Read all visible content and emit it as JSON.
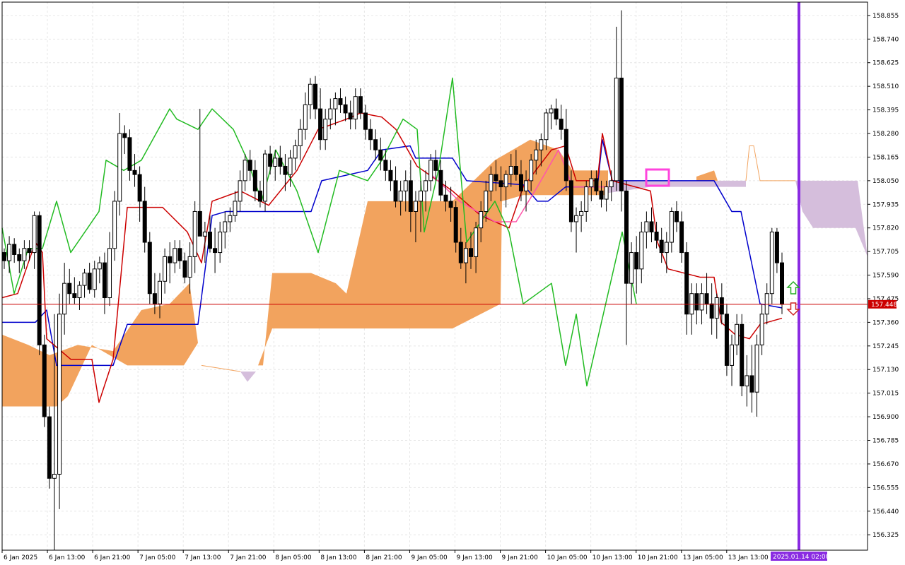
{
  "chart_data": {
    "type": "candlestick",
    "instrument_note": "",
    "y_range": [
      156.25,
      158.92
    ],
    "y_ticks": [
      "158.855",
      "158.740",
      "158.625",
      "158.510",
      "158.395",
      "158.280",
      "158.165",
      "158.050",
      "157.935",
      "157.820",
      "157.705",
      "157.590",
      "157.475",
      "157.360",
      "157.245",
      "157.130",
      "157.015",
      "156.900",
      "156.785",
      "156.670",
      "156.555",
      "156.440",
      "156.325"
    ],
    "x_labels": [
      "6 Jan 2025",
      "6 Jan 13:00",
      "6 Jan 21:00",
      "7 Jan 05:00",
      "7 Jan 13:00",
      "7 Jan 21:00",
      "8 Jan 05:00",
      "8 Jan 13:00",
      "8 Jan 21:00",
      "9 Jan 05:00",
      "9 Jan 13:00",
      "9 Jan 21:00",
      "10 Jan 05:00",
      "10 Jan 13:00",
      "10 Jan 21:00",
      "13 Jan 05:00",
      "13 Jan 13:00"
    ],
    "current_price": "157.448",
    "current_time_label": "2025.01.14 02:00",
    "candles": [
      [
        157.7,
        157.72,
        157.62,
        157.66
      ],
      [
        157.66,
        157.78,
        157.6,
        157.74
      ],
      [
        157.74,
        157.77,
        157.65,
        157.69
      ],
      [
        157.69,
        157.72,
        157.6,
        157.66
      ],
      [
        157.66,
        157.76,
        157.62,
        157.72
      ],
      [
        157.72,
        157.76,
        157.66,
        157.7
      ],
      [
        157.7,
        157.9,
        157.62,
        157.88
      ],
      [
        157.88,
        157.9,
        157.2,
        157.25
      ],
      [
        157.25,
        157.3,
        156.85,
        156.9
      ],
      [
        156.9,
        156.95,
        156.55,
        156.6
      ],
      [
        156.6,
        157.4,
        156.25,
        156.62
      ],
      [
        156.62,
        157.5,
        156.45,
        157.4
      ],
      [
        157.4,
        157.65,
        157.3,
        157.55
      ],
      [
        157.55,
        157.62,
        157.45,
        157.5
      ],
      [
        157.5,
        157.58,
        157.45,
        157.48
      ],
      [
        157.48,
        157.56,
        157.42,
        157.54
      ],
      [
        157.54,
        157.62,
        157.48,
        157.6
      ],
      [
        157.6,
        157.65,
        157.5,
        157.52
      ],
      [
        157.52,
        157.66,
        157.48,
        157.62
      ],
      [
        157.62,
        157.68,
        157.55,
        157.65
      ],
      [
        157.65,
        157.7,
        157.4,
        157.48
      ],
      [
        157.48,
        157.8,
        157.44,
        157.72
      ],
      [
        157.72,
        158.0,
        157.66,
        157.95
      ],
      [
        157.95,
        158.38,
        157.88,
        158.28
      ],
      [
        158.28,
        158.32,
        158.18,
        158.26
      ],
      [
        158.26,
        158.3,
        158.05,
        158.1
      ],
      [
        158.1,
        158.18,
        158.02,
        158.08
      ],
      [
        158.08,
        158.12,
        157.85,
        157.95
      ],
      [
        157.95,
        158.02,
        157.7,
        157.75
      ],
      [
        157.75,
        157.8,
        157.45,
        157.5
      ],
      [
        157.5,
        157.6,
        157.4,
        157.45
      ],
      [
        157.45,
        157.6,
        157.38,
        157.56
      ],
      [
        157.56,
        157.72,
        157.5,
        157.68
      ],
      [
        157.68,
        157.75,
        157.55,
        157.65
      ],
      [
        157.65,
        157.76,
        157.6,
        157.72
      ],
      [
        157.72,
        157.76,
        157.62,
        157.66
      ],
      [
        157.66,
        157.7,
        157.55,
        157.58
      ],
      [
        157.58,
        157.75,
        157.5,
        157.68
      ],
      [
        157.68,
        157.95,
        157.6,
        157.9
      ],
      [
        157.9,
        158.4,
        157.82,
        157.78
      ],
      [
        157.78,
        157.85,
        157.65,
        157.8
      ],
      [
        157.8,
        157.88,
        157.7,
        157.72
      ],
      [
        157.72,
        157.82,
        157.6,
        157.7
      ],
      [
        157.7,
        157.85,
        157.65,
        157.8
      ],
      [
        157.8,
        157.9,
        157.72,
        157.85
      ],
      [
        157.85,
        157.92,
        157.8,
        157.88
      ],
      [
        157.88,
        158.0,
        157.85,
        157.95
      ],
      [
        157.95,
        158.1,
        157.9,
        158.05
      ],
      [
        158.05,
        158.18,
        158.0,
        158.15
      ],
      [
        158.15,
        158.2,
        158.05,
        158.1
      ],
      [
        158.1,
        158.15,
        157.95,
        158.0
      ],
      [
        158.0,
        158.05,
        157.92,
        157.95
      ],
      [
        157.95,
        158.2,
        157.9,
        158.18
      ],
      [
        158.18,
        158.22,
        158.08,
        158.12
      ],
      [
        158.12,
        158.2,
        158.05,
        158.16
      ],
      [
        158.16,
        158.22,
        158.08,
        158.12
      ],
      [
        158.12,
        158.18,
        158.0,
        158.08
      ],
      [
        158.08,
        158.2,
        158.02,
        158.16
      ],
      [
        158.16,
        158.25,
        158.1,
        158.22
      ],
      [
        158.22,
        158.35,
        158.15,
        158.3
      ],
      [
        158.3,
        158.48,
        158.25,
        158.42
      ],
      [
        158.42,
        158.55,
        158.35,
        158.52
      ],
      [
        158.52,
        158.56,
        158.35,
        158.4
      ],
      [
        158.4,
        158.5,
        158.2,
        158.25
      ],
      [
        158.25,
        158.4,
        158.2,
        158.35
      ],
      [
        158.35,
        158.45,
        158.3,
        158.4
      ],
      [
        158.4,
        158.48,
        158.32,
        158.45
      ],
      [
        158.45,
        158.5,
        158.38,
        158.42
      ],
      [
        158.42,
        158.46,
        158.34,
        158.38
      ],
      [
        158.38,
        158.44,
        158.3,
        158.35
      ],
      [
        158.35,
        158.5,
        158.3,
        158.46
      ],
      [
        158.46,
        158.5,
        158.35,
        158.38
      ],
      [
        158.38,
        158.42,
        158.25,
        158.3
      ],
      [
        158.3,
        158.35,
        158.2,
        158.25
      ],
      [
        158.25,
        158.3,
        158.15,
        158.2
      ],
      [
        158.2,
        158.26,
        158.1,
        158.15
      ],
      [
        158.15,
        158.2,
        158.05,
        158.1
      ],
      [
        158.1,
        158.15,
        158.0,
        158.05
      ],
      [
        158.05,
        158.12,
        157.92,
        157.95
      ],
      [
        157.95,
        158.05,
        157.88,
        158.0
      ],
      [
        158.0,
        158.1,
        157.9,
        158.05
      ],
      [
        158.05,
        158.15,
        157.8,
        157.9
      ],
      [
        157.9,
        158.0,
        157.75,
        157.95
      ],
      [
        157.95,
        158.05,
        157.8,
        158.0
      ],
      [
        158.0,
        158.1,
        157.9,
        158.05
      ],
      [
        158.05,
        158.18,
        158.0,
        158.15
      ],
      [
        158.15,
        158.2,
        158.05,
        158.1
      ],
      [
        158.1,
        158.15,
        157.95,
        157.98
      ],
      [
        157.98,
        158.05,
        157.9,
        157.95
      ],
      [
        157.95,
        158.02,
        157.85,
        157.92
      ],
      [
        157.92,
        157.95,
        157.7,
        157.75
      ],
      [
        157.75,
        157.82,
        157.62,
        157.65
      ],
      [
        157.65,
        157.75,
        157.55,
        157.72
      ],
      [
        157.72,
        157.8,
        157.62,
        157.68
      ],
      [
        157.68,
        157.85,
        157.6,
        157.82
      ],
      [
        157.82,
        157.95,
        157.75,
        157.9
      ],
      [
        157.9,
        158.05,
        157.85,
        158.0
      ],
      [
        158.0,
        158.12,
        157.95,
        158.08
      ],
      [
        158.08,
        158.15,
        158.0,
        158.05
      ],
      [
        158.05,
        158.12,
        157.95,
        158.02
      ],
      [
        158.02,
        158.1,
        157.92,
        158.08
      ],
      [
        158.08,
        158.18,
        158.02,
        158.12
      ],
      [
        158.12,
        158.2,
        158.05,
        158.08
      ],
      [
        158.08,
        158.15,
        157.95,
        158.0
      ],
      [
        158.0,
        158.1,
        157.9,
        158.05
      ],
      [
        158.05,
        158.18,
        158.0,
        158.15
      ],
      [
        158.15,
        158.25,
        158.08,
        158.2
      ],
      [
        158.2,
        158.28,
        158.12,
        158.25
      ],
      [
        158.25,
        158.4,
        158.2,
        158.38
      ],
      [
        158.38,
        158.42,
        158.3,
        158.4
      ],
      [
        158.4,
        158.45,
        158.32,
        158.35
      ],
      [
        158.35,
        158.42,
        158.25,
        158.3
      ],
      [
        158.3,
        158.4,
        158.0,
        158.05
      ],
      [
        158.05,
        158.1,
        157.8,
        157.85
      ],
      [
        157.85,
        157.92,
        157.7,
        157.88
      ],
      [
        157.88,
        157.95,
        157.8,
        157.9
      ],
      [
        157.9,
        158.05,
        157.85,
        158.02
      ],
      [
        158.02,
        158.1,
        157.95,
        158.06
      ],
      [
        158.06,
        158.1,
        157.98,
        158.0
      ],
      [
        158.0,
        158.05,
        157.92,
        157.96
      ],
      [
        157.96,
        158.05,
        157.9,
        158.02
      ],
      [
        158.02,
        158.1,
        157.95,
        158.05
      ],
      [
        158.05,
        158.8,
        158.0,
        158.55
      ],
      [
        158.55,
        158.88,
        157.9,
        158.0
      ],
      [
        158.0,
        158.05,
        157.25,
        157.55
      ],
      [
        157.55,
        157.75,
        157.45,
        157.7
      ],
      [
        157.7,
        157.78,
        157.5,
        157.62
      ],
      [
        157.62,
        157.85,
        157.55,
        157.8
      ],
      [
        157.8,
        157.9,
        157.72,
        157.85
      ],
      [
        157.85,
        157.92,
        157.75,
        157.8
      ],
      [
        157.8,
        157.85,
        157.72,
        157.76
      ],
      [
        157.76,
        157.82,
        157.65,
        157.7
      ],
      [
        157.7,
        157.8,
        157.6,
        157.75
      ],
      [
        157.75,
        157.92,
        157.7,
        157.9
      ],
      [
        157.9,
        157.95,
        157.8,
        157.85
      ],
      [
        157.85,
        157.9,
        157.65,
        157.7
      ],
      [
        157.7,
        157.75,
        157.3,
        157.4
      ],
      [
        157.4,
        157.55,
        157.3,
        157.5
      ],
      [
        157.5,
        157.55,
        157.35,
        157.42
      ],
      [
        157.42,
        157.55,
        157.35,
        157.5
      ],
      [
        157.5,
        157.6,
        157.4,
        157.45
      ],
      [
        157.45,
        157.55,
        157.3,
        157.38
      ],
      [
        157.38,
        157.5,
        157.28,
        157.48
      ],
      [
        157.48,
        157.55,
        157.35,
        157.4
      ],
      [
        157.4,
        157.45,
        157.1,
        157.15
      ],
      [
        157.15,
        157.3,
        157.05,
        157.25
      ],
      [
        157.25,
        157.4,
        157.2,
        157.35
      ],
      [
        157.35,
        157.4,
        157.0,
        157.05
      ],
      [
        157.05,
        157.2,
        156.95,
        157.1
      ],
      [
        157.1,
        157.25,
        156.92,
        157.02
      ],
      [
        157.02,
        157.3,
        156.9,
        157.25
      ],
      [
        157.25,
        157.45,
        157.2,
        157.4
      ],
      [
        157.4,
        157.55,
        157.35,
        157.5
      ],
      [
        157.5,
        157.82,
        157.45,
        157.8
      ],
      [
        157.8,
        157.82,
        157.6,
        157.65
      ],
      [
        157.65,
        157.7,
        157.4,
        157.448
      ]
    ],
    "series": [
      {
        "name": "",
        "color": "#cc0000",
        "note": ""
      },
      {
        "name": "",
        "color": "#0000cc",
        "note": ""
      },
      {
        "name": "",
        "color": "#22bb22",
        "note": ""
      }
    ]
  },
  "colors": {
    "cloud_bull": "#f2a35e",
    "cloud_bear": "#d5bedc",
    "tenkan": "#cc0000",
    "kijun": "#0000cc",
    "chikou": "#22bb22",
    "pink_line": "#ff55aa",
    "grid": "#e6e6e6",
    "price_line": "#cc0000",
    "time_marker": "#8a2be2",
    "box": "#ff44dd"
  },
  "icons": {
    "up": "up-arrow-icon",
    "down": "down-arrow-icon"
  }
}
